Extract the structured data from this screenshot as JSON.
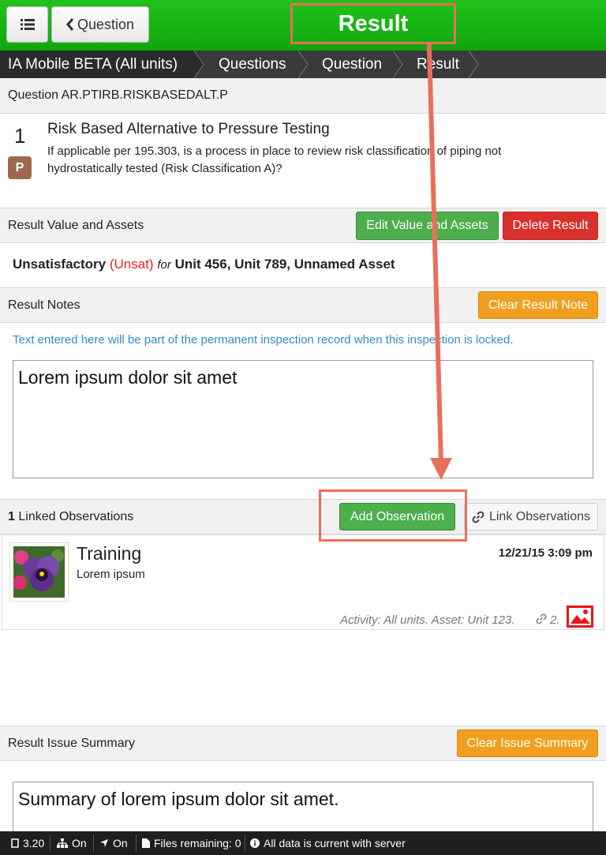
{
  "header": {
    "menu_icon": "list-icon",
    "back_label": "Question",
    "back_icon": "chevron-left-icon",
    "title": "Result"
  },
  "breadcrumb": {
    "app": "IA Mobile BETA (All units)",
    "items": [
      "Questions",
      "Question",
      "Result"
    ]
  },
  "question": {
    "id_label": "Question AR.PTIRB.RISKBASEDALT.P",
    "number": "1",
    "badge": "P",
    "title": "Risk Based Alternative to Pressure Testing",
    "text": "If applicable per 195.303, is a process in place to review risk classification of piping not hydrostatically tested (Risk Classification A)?"
  },
  "result_value": {
    "header": "Result Value and Assets",
    "edit_label": "Edit Value and Assets",
    "delete_label": "Delete Result",
    "value": "Unsatisfactory",
    "code": "(Unsat)",
    "for_word": "for",
    "assets": "Unit 456, Unit 789, Unnamed Asset"
  },
  "result_notes": {
    "header": "Result Notes",
    "clear_label": "Clear Result Note",
    "hint": "Text entered here will be part of the permanent inspection record when this inspection is locked.",
    "value": "Lorem ipsum dolor sit amet"
  },
  "observations": {
    "count": "1",
    "header": "Linked Observations",
    "add_label": "Add Observation",
    "link_label": "Link Observations",
    "link_icon": "link-icon",
    "items": [
      {
        "title": "Training",
        "subtitle": "Lorem ipsum",
        "timestamp": "12/21/15 3:09 pm",
        "meta": "Activity: All units. Asset: Unit 123.",
        "link_count": "2.",
        "image_icon": "image-icon"
      }
    ]
  },
  "issue_summary": {
    "header": "Result Issue Summary",
    "clear_label": "Clear Issue Summary",
    "value": "Summary of lorem ipsum dolor sit amet."
  },
  "footer": {
    "version": "3.20",
    "network_status": "On",
    "location_status": "On",
    "files_remaining": "Files remaining: 0",
    "sync_status": "All data is current with server"
  },
  "colors": {
    "header_green": "#1ab415",
    "highlight": "#e8705a",
    "unsat_red": "#e8231e",
    "hint_blue": "#2e8fc4"
  }
}
